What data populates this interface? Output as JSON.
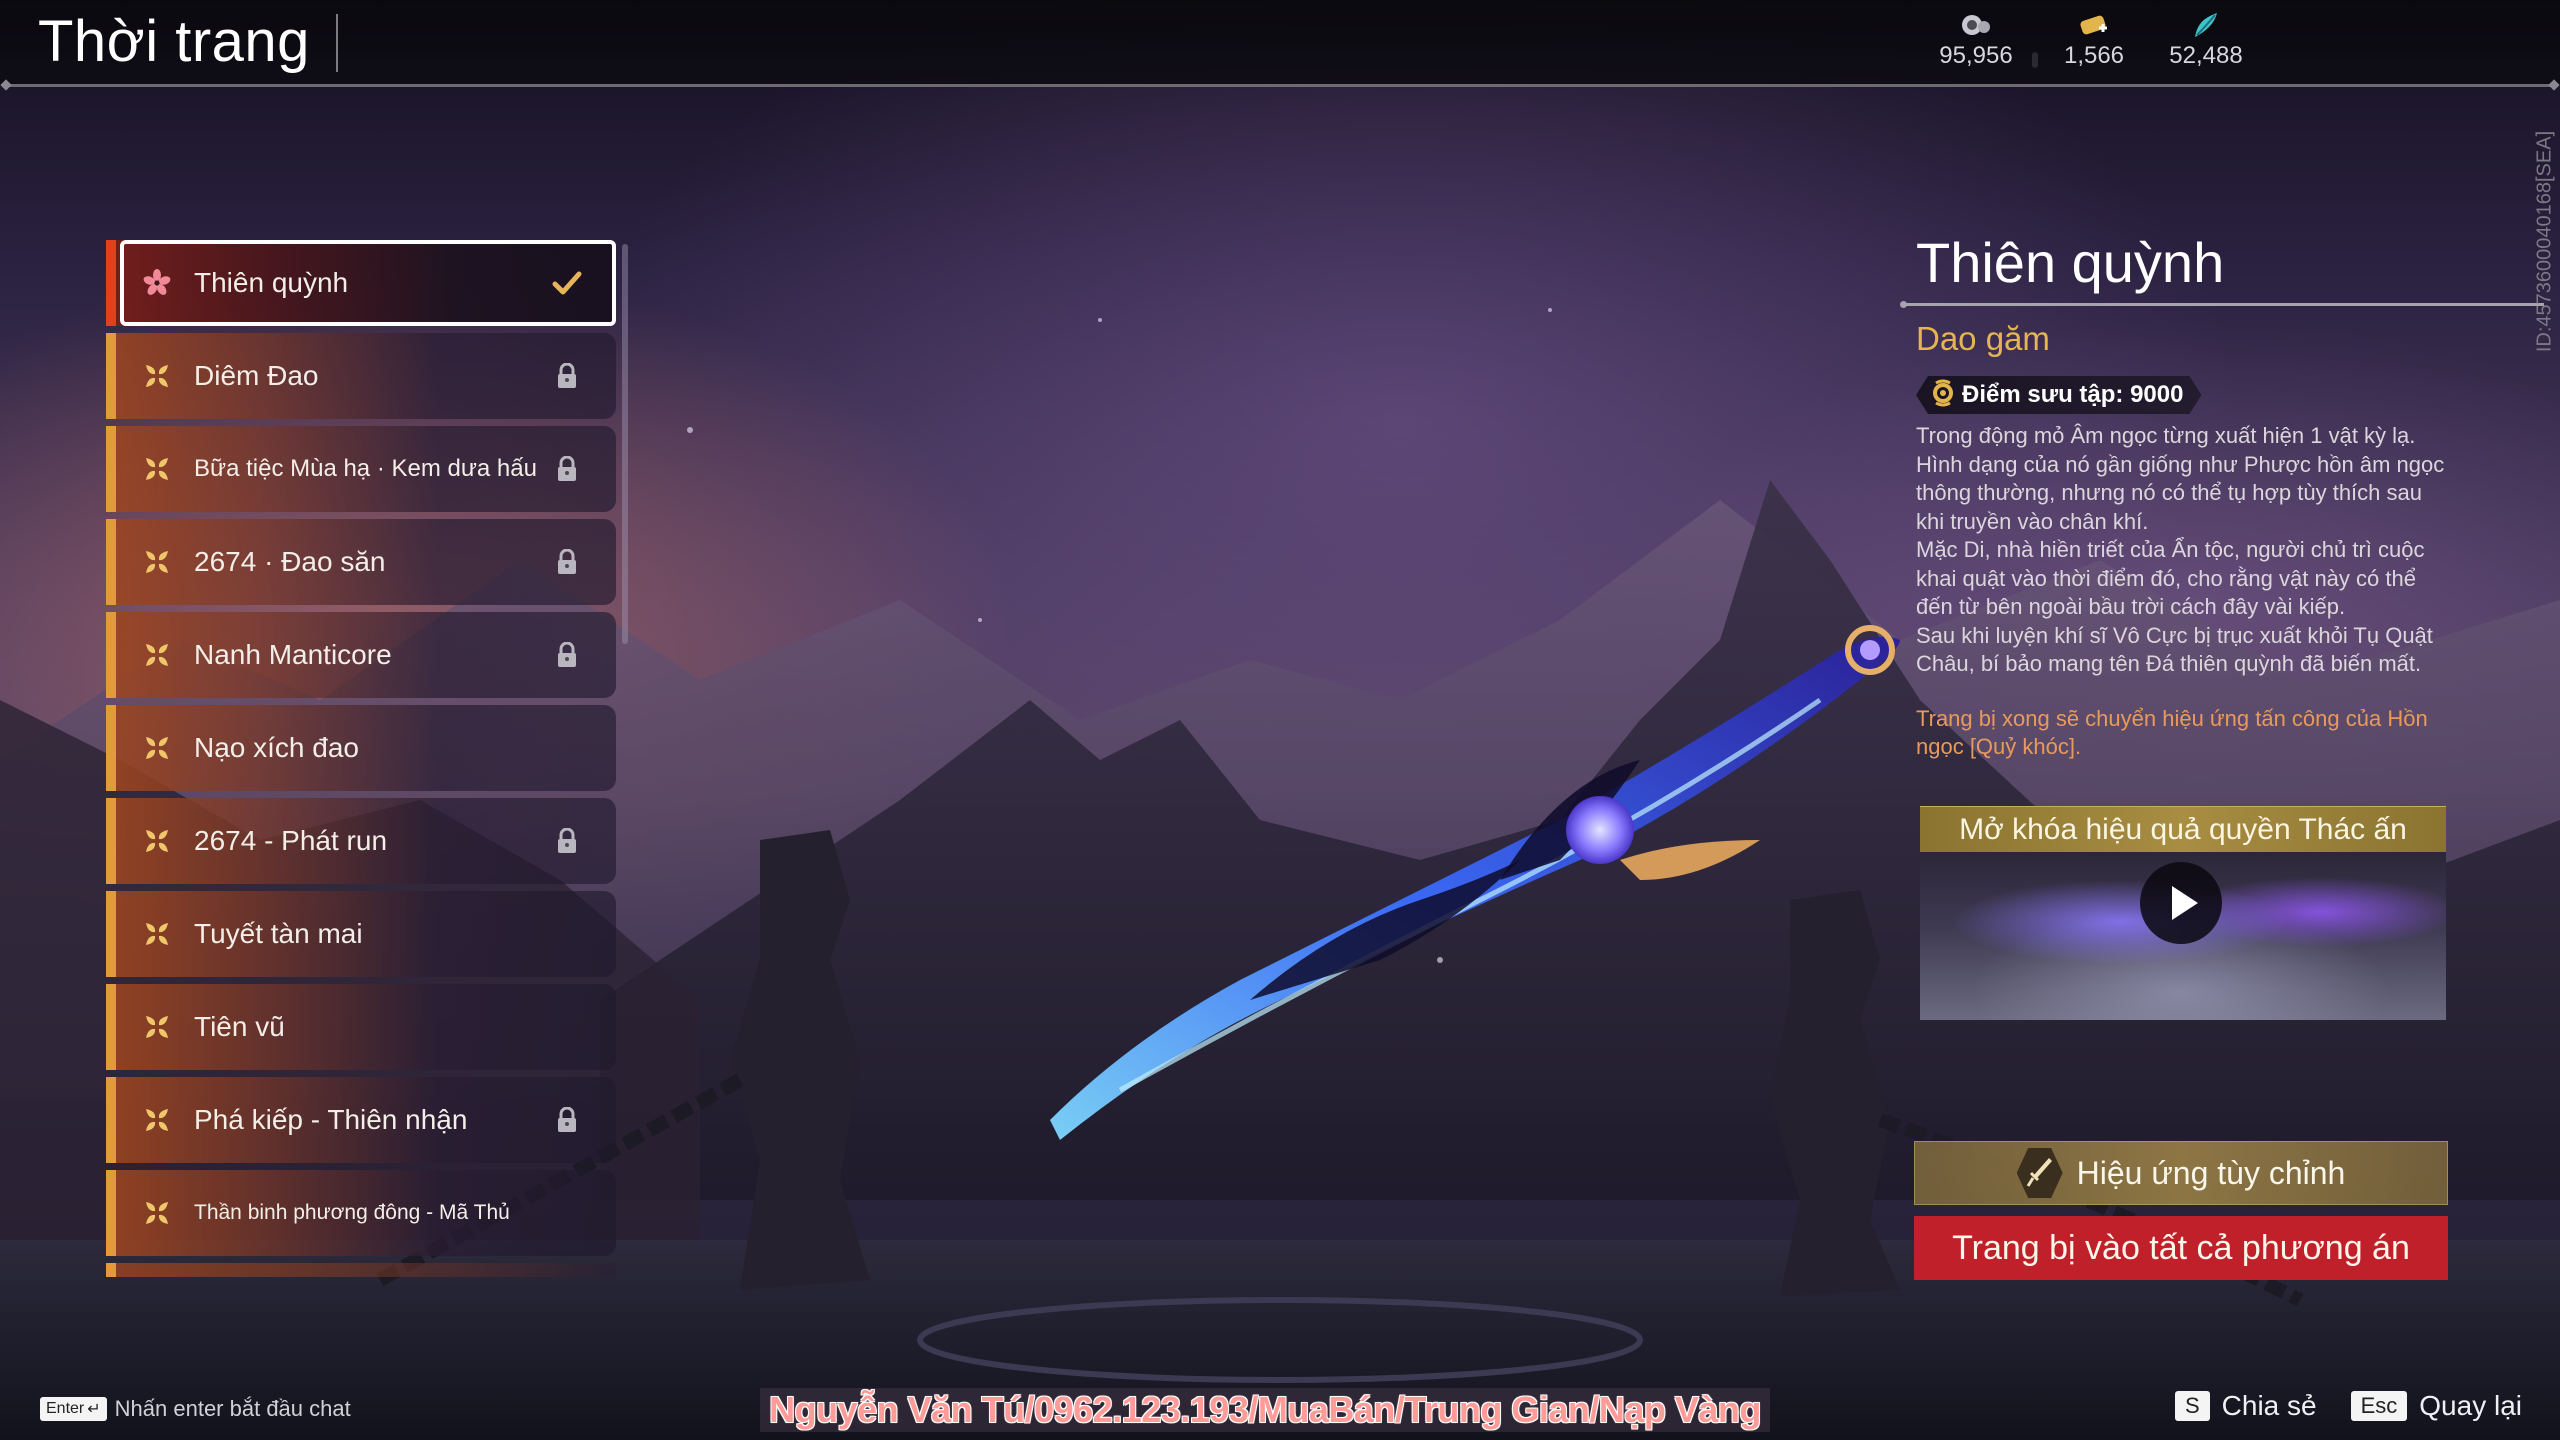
{
  "header": {
    "title": "Thời trang",
    "currencies": [
      {
        "icon": "silver-coin-icon",
        "value": "95,956"
      },
      {
        "icon": "gold-ingot-icon",
        "value": "1,566"
      },
      {
        "icon": "jade-feather-icon",
        "value": "52,488"
      }
    ]
  },
  "list": {
    "items": [
      {
        "label": "Thiên quỳnh",
        "selected": true,
        "status": "equipped"
      },
      {
        "label": "Diêm Đao",
        "selected": false,
        "status": "locked"
      },
      {
        "label": "Bữa tiệc Mùa hạ · Kem dưa hấu",
        "selected": false,
        "status": "locked"
      },
      {
        "label": "2674 · Đao săn",
        "selected": false,
        "status": "locked"
      },
      {
        "label": "Nanh Manticore",
        "selected": false,
        "status": "locked"
      },
      {
        "label": "Nạo xích đao",
        "selected": false,
        "status": "unlocked"
      },
      {
        "label": "2674 - Phát run",
        "selected": false,
        "status": "locked"
      },
      {
        "label": "Tuyết tàn mai",
        "selected": false,
        "status": "unlocked"
      },
      {
        "label": "Tiên vũ",
        "selected": false,
        "status": "unlocked"
      },
      {
        "label": "Phá kiếp - Thiên nhận",
        "selected": false,
        "status": "locked"
      },
      {
        "label": "Thần binh phương đông - Mã Thủ",
        "selected": false,
        "status": "unlocked"
      }
    ]
  },
  "detail": {
    "title": "Thiên quỳnh",
    "type": "Dao găm",
    "collection_points": "Điểm sưu tập: 9000",
    "description": "Trong động mỏ Âm ngọc từng xuất hiện 1 vật kỳ lạ.\nHình dạng của nó gần giống như Phược hồn âm ngọc thông thường, nhưng nó có thể tụ hợp tùy thích sau khi truyền vào chân khí.\nMặc Di, nhà hiền triết của Ẩn tộc, người chủ trì cuộc khai quật vào thời điểm đó, cho rằng vật này có thể đến từ bên ngoài bầu trời cách đây vài kiếp.\nSau khi luyện khí sĩ Vô Cực bị trục xuất khỏi Tụ Quật Châu, bí bảo mang tên Đá thiên quỳnh đã biến mất.",
    "note": "Trang bị xong sẽ chuyển hiệu ứng tấn công của Hồn ngọc [Quỷ khóc].",
    "video_title": "Mở khóa hiệu quả quyền Thác ấn",
    "custom_effect_label": "Hiệu ứng tùy chỉnh",
    "equip_all_label": "Trang bị vào tất cả phương án",
    "server_id": "ID:4573600040168[SEA]"
  },
  "footer": {
    "chat_key": "Enter",
    "chat_hint": "Nhấn enter bắt đầu chat",
    "watermark": "Nguyễn Văn Tú/0962.123.193/MuaBán/Trung Gian/Nạp Vàng",
    "share_key": "S",
    "share_label": "Chia sẻ",
    "back_key": "Esc",
    "back_label": "Quay lại"
  },
  "colors": {
    "accent_gold": "#e6b552",
    "selected_bar": "#e0401f",
    "item_bar": "#e39a3a",
    "equip_button": "#c0202a",
    "note_text": "#e89a5a"
  }
}
